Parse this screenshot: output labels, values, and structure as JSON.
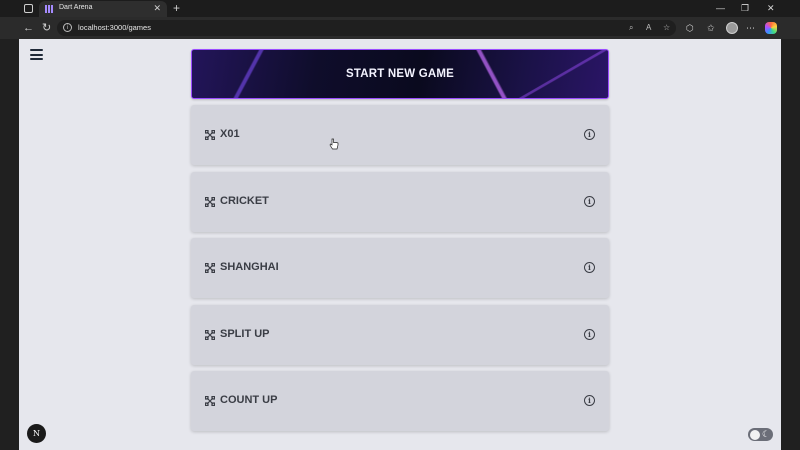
{
  "browser": {
    "tab_title": "Dart Arena",
    "tab_close": "✕",
    "new_tab": "+",
    "url": "localhost:3000/games",
    "window_controls": {
      "minimize": "—",
      "restore": "❐",
      "close": "✕"
    }
  },
  "app": {
    "start_button_label": "START NEW GAME",
    "games": [
      {
        "label": "X01",
        "icon": "dart-icon",
        "info_icon": "info-icon"
      },
      {
        "label": "CRICKET",
        "icon": "dart-icon",
        "info_icon": "info-icon"
      },
      {
        "label": "SHANGHAI",
        "icon": "dart-icon",
        "info_icon": "info-icon"
      },
      {
        "label": "SPLIT UP",
        "icon": "dart-icon",
        "info_icon": "info-icon"
      },
      {
        "label": "COUNT UP",
        "icon": "dart-icon",
        "info_icon": "info-icon"
      }
    ],
    "next_badge": "N"
  },
  "colors": {
    "page_background": "#e6e7ed",
    "card_background": "#d3d4dc",
    "banner_border": "#9b4dff",
    "text": "#3a3d45"
  }
}
